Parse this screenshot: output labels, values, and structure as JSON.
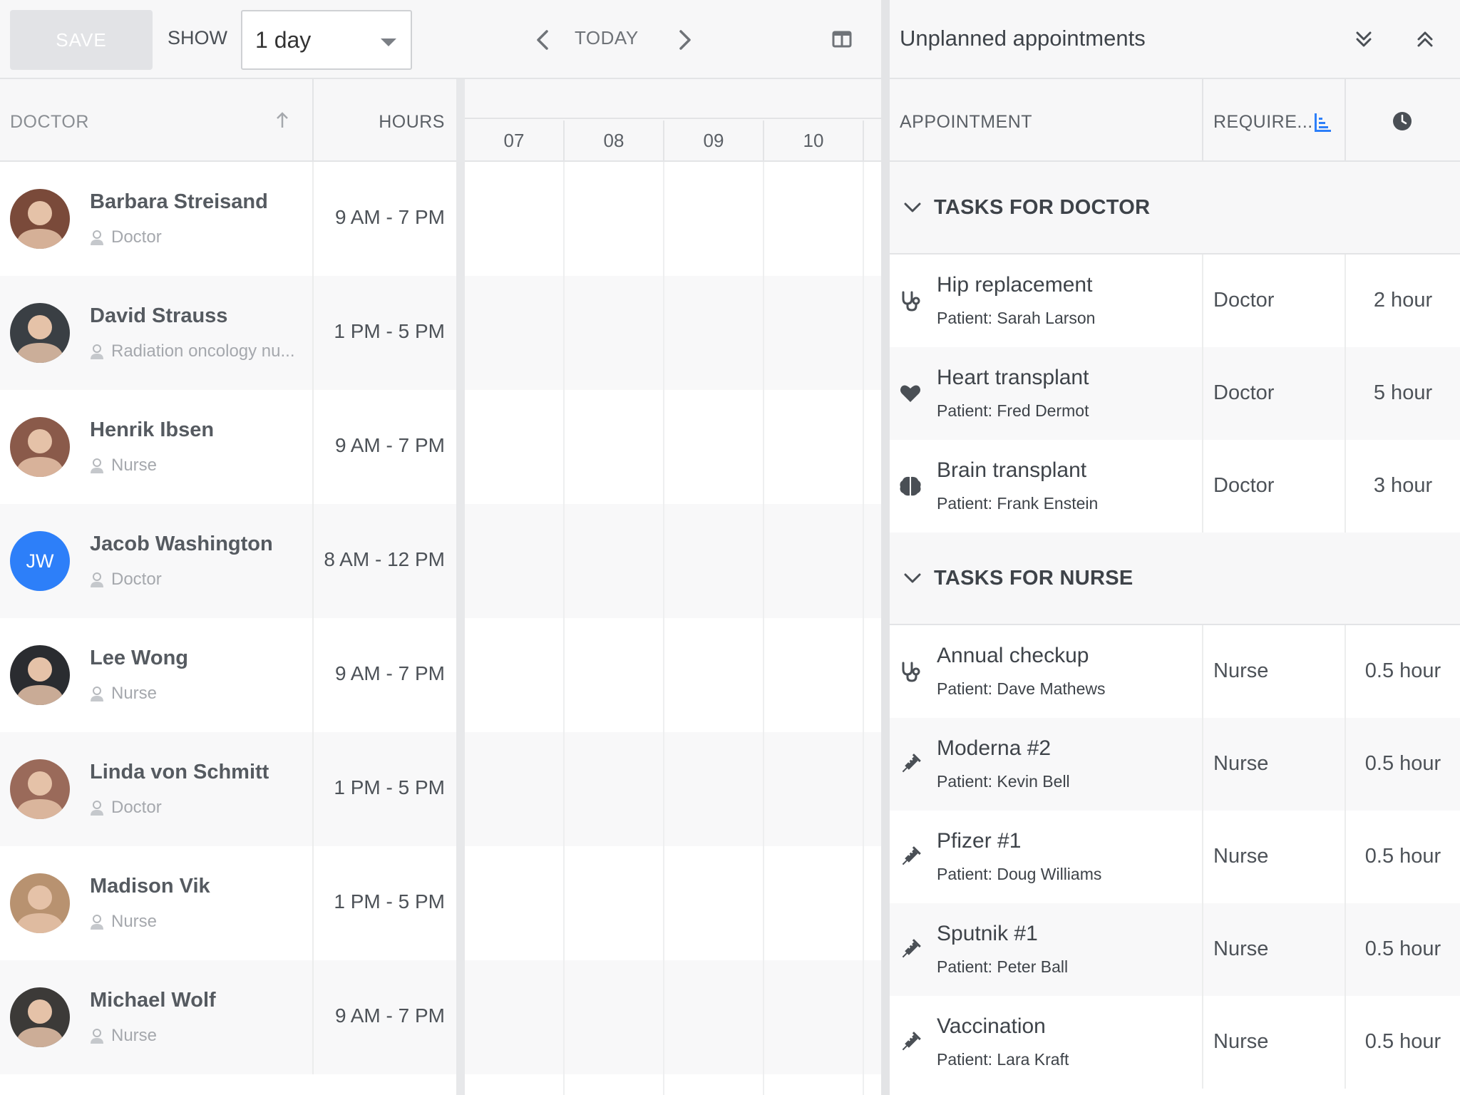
{
  "toolbar": {
    "save_label": "SAVE",
    "show_label": "SHOW",
    "range_value": "1 day",
    "today_label": "TODAY"
  },
  "grid": {
    "doctor_header": "DOCTOR",
    "hours_header": "HOURS",
    "hour_ticks": [
      "07",
      "08",
      "09",
      "10"
    ]
  },
  "resources": [
    {
      "name": "Barbara Streisand",
      "role": "Doctor",
      "hours": "9 AM - 7 PM",
      "avatar_color": "#7a4a3a"
    },
    {
      "name": "David Strauss",
      "role": "Radiation oncology nu...",
      "hours": "1 PM - 5 PM",
      "avatar_color": "#3a3f44"
    },
    {
      "name": "Henrik Ibsen",
      "role": "Nurse",
      "hours": "9 AM - 7 PM",
      "avatar_color": "#8a5a4a"
    },
    {
      "name": "Jacob Washington",
      "role": "Doctor",
      "hours": "8 AM - 12 PM",
      "avatar_initials": "JW",
      "avatar_color": "#2d7ff9"
    },
    {
      "name": "Lee Wong",
      "role": "Nurse",
      "hours": "9 AM - 7 PM",
      "avatar_color": "#2a2c30"
    },
    {
      "name": "Linda von Schmitt",
      "role": "Doctor",
      "hours": "1 PM - 5 PM",
      "avatar_color": "#9a6a5a"
    },
    {
      "name": "Madison Vik",
      "role": "Nurse",
      "hours": "1 PM - 5 PM",
      "avatar_color": "#b89270"
    },
    {
      "name": "Michael Wolf",
      "role": "Nurse",
      "hours": "9 AM - 7 PM",
      "avatar_color": "#3c3a38"
    }
  ],
  "unplanned": {
    "title": "Unplanned appointments",
    "appointment_header": "APPOINTMENT",
    "requires_header": "REQUIRE...",
    "groups": [
      {
        "label": "TASKS FOR DOCTOR",
        "tasks": [
          {
            "name": "Hip replacement",
            "patient": "Patient: Sarah Larson",
            "requires": "Doctor",
            "duration": "2 hour",
            "icon": "stethoscope-icon"
          },
          {
            "name": "Heart transplant",
            "patient": "Patient: Fred Dermot",
            "requires": "Doctor",
            "duration": "5 hour",
            "icon": "heart-icon"
          },
          {
            "name": "Brain transplant",
            "patient": "Patient: Frank Enstein",
            "requires": "Doctor",
            "duration": "3 hour",
            "icon": "brain-icon"
          }
        ]
      },
      {
        "label": "TASKS FOR NURSE",
        "tasks": [
          {
            "name": "Annual checkup",
            "patient": "Patient: Dave Mathews",
            "requires": "Nurse",
            "duration": "0.5 hour",
            "icon": "stethoscope-icon"
          },
          {
            "name": "Moderna #2",
            "patient": "Patient: Kevin Bell",
            "requires": "Nurse",
            "duration": "0.5 hour",
            "icon": "syringe-icon"
          },
          {
            "name": "Pfizer #1",
            "patient": "Patient: Doug Williams",
            "requires": "Nurse",
            "duration": "0.5 hour",
            "icon": "syringe-icon"
          },
          {
            "name": "Sputnik #1",
            "patient": "Patient: Peter Ball",
            "requires": "Nurse",
            "duration": "0.5 hour",
            "icon": "syringe-icon"
          },
          {
            "name": "Vaccination",
            "patient": "Patient: Lara Kraft",
            "requires": "Nurse",
            "duration": "0.5 hour",
            "icon": "syringe-icon"
          }
        ]
      }
    ]
  },
  "colors": {
    "accent": "#2d7ff9"
  }
}
